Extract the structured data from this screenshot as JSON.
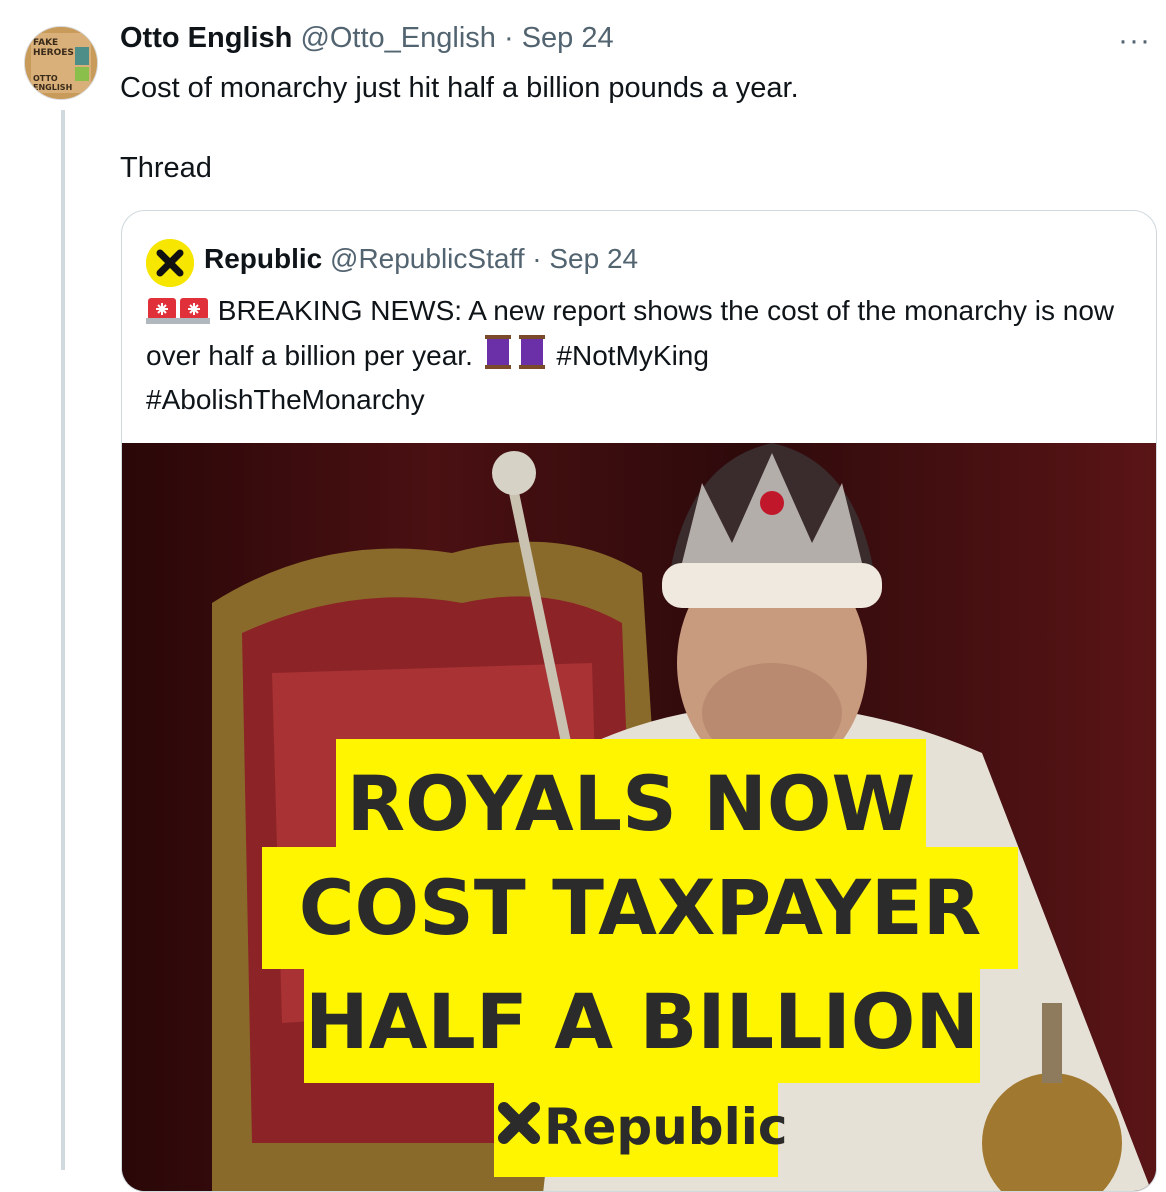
{
  "tweet": {
    "author_name": "Otto English",
    "author_handle": "@Otto_English",
    "separator": " · ",
    "date": "Sep 24",
    "more_icon": "···",
    "text_line1": "Cost of monarchy just hit half a billion pounds a year.",
    "text_line2": "Thread",
    "avatar_book_title_top": "FAKE HEROES",
    "avatar_book_title_bottom": "OTTO ENGLISH"
  },
  "quote": {
    "author_name": "Republic",
    "author_handle": "@RepublicStaff",
    "separator": " · ",
    "date": "Sep 24",
    "text_main": "BREAKING NEWS: A new report shows the cost of the monarchy is now over half a billion per year.",
    "hashtag1": "#NotMyKing",
    "hashtag2": "#AbolishTheMonarchy",
    "media": {
      "headline_line1": "ROYALS NOW",
      "headline_line2": "COST TAXPAYER",
      "headline_line3": "HALF A BILLION",
      "brand": "Republic"
    }
  },
  "colors": {
    "accent_yellow": "#fff500",
    "text": "#0f1419",
    "meta": "#536471",
    "border": "#cfd9de"
  }
}
